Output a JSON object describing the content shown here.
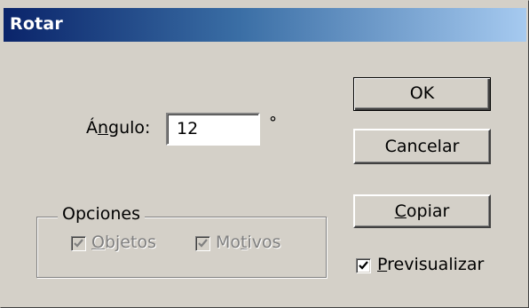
{
  "window": {
    "title": "Rotar"
  },
  "angle": {
    "label_pre": "Á",
    "label_mnemonic": "n",
    "label_post": "gulo:",
    "value": "12",
    "unit": "°"
  },
  "buttons": {
    "ok": "OK",
    "cancel": "Cancelar",
    "copy_mnemonic": "C",
    "copy_rest": "opiar"
  },
  "options": {
    "legend": "Opciones",
    "objects": {
      "mnemonic": "O",
      "rest": "bjetos",
      "checked": true,
      "enabled": false
    },
    "patterns": {
      "pre": "Mo",
      "mnemonic": "t",
      "post": "ivos",
      "checked": true,
      "enabled": false
    }
  },
  "preview": {
    "mnemonic": "P",
    "rest": "revisualizar",
    "checked": true
  }
}
